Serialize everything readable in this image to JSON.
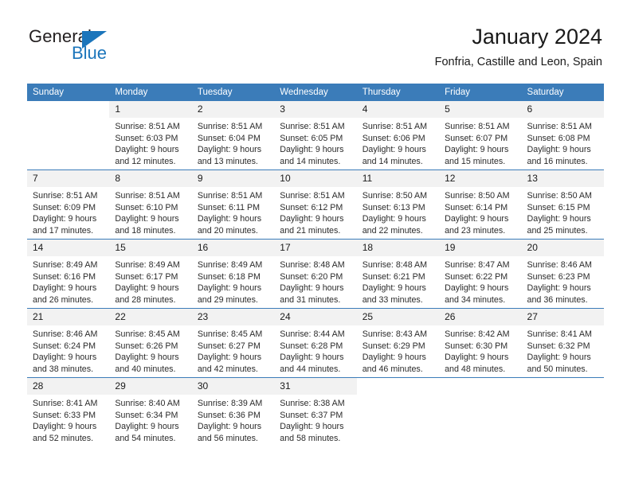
{
  "brand": {
    "name_part1": "General",
    "name_part2": "Blue",
    "triangle_color": "#1b75bb"
  },
  "header": {
    "title": "January 2024",
    "subtitle": "Fonfria, Castille and Leon, Spain",
    "accent_color": "#3b7cb9"
  },
  "weekdays": [
    "Sunday",
    "Monday",
    "Tuesday",
    "Wednesday",
    "Thursday",
    "Friday",
    "Saturday"
  ],
  "weeks": [
    [
      {
        "day": "",
        "blank": true
      },
      {
        "day": "1",
        "sunrise": "Sunrise: 8:51 AM",
        "sunset": "Sunset: 6:03 PM",
        "daylight1": "Daylight: 9 hours",
        "daylight2": "and 12 minutes."
      },
      {
        "day": "2",
        "sunrise": "Sunrise: 8:51 AM",
        "sunset": "Sunset: 6:04 PM",
        "daylight1": "Daylight: 9 hours",
        "daylight2": "and 13 minutes."
      },
      {
        "day": "3",
        "sunrise": "Sunrise: 8:51 AM",
        "sunset": "Sunset: 6:05 PM",
        "daylight1": "Daylight: 9 hours",
        "daylight2": "and 14 minutes."
      },
      {
        "day": "4",
        "sunrise": "Sunrise: 8:51 AM",
        "sunset": "Sunset: 6:06 PM",
        "daylight1": "Daylight: 9 hours",
        "daylight2": "and 14 minutes."
      },
      {
        "day": "5",
        "sunrise": "Sunrise: 8:51 AM",
        "sunset": "Sunset: 6:07 PM",
        "daylight1": "Daylight: 9 hours",
        "daylight2": "and 15 minutes."
      },
      {
        "day": "6",
        "sunrise": "Sunrise: 8:51 AM",
        "sunset": "Sunset: 6:08 PM",
        "daylight1": "Daylight: 9 hours",
        "daylight2": "and 16 minutes."
      }
    ],
    [
      {
        "day": "7",
        "sunrise": "Sunrise: 8:51 AM",
        "sunset": "Sunset: 6:09 PM",
        "daylight1": "Daylight: 9 hours",
        "daylight2": "and 17 minutes."
      },
      {
        "day": "8",
        "sunrise": "Sunrise: 8:51 AM",
        "sunset": "Sunset: 6:10 PM",
        "daylight1": "Daylight: 9 hours",
        "daylight2": "and 18 minutes."
      },
      {
        "day": "9",
        "sunrise": "Sunrise: 8:51 AM",
        "sunset": "Sunset: 6:11 PM",
        "daylight1": "Daylight: 9 hours",
        "daylight2": "and 20 minutes."
      },
      {
        "day": "10",
        "sunrise": "Sunrise: 8:51 AM",
        "sunset": "Sunset: 6:12 PM",
        "daylight1": "Daylight: 9 hours",
        "daylight2": "and 21 minutes."
      },
      {
        "day": "11",
        "sunrise": "Sunrise: 8:50 AM",
        "sunset": "Sunset: 6:13 PM",
        "daylight1": "Daylight: 9 hours",
        "daylight2": "and 22 minutes."
      },
      {
        "day": "12",
        "sunrise": "Sunrise: 8:50 AM",
        "sunset": "Sunset: 6:14 PM",
        "daylight1": "Daylight: 9 hours",
        "daylight2": "and 23 minutes."
      },
      {
        "day": "13",
        "sunrise": "Sunrise: 8:50 AM",
        "sunset": "Sunset: 6:15 PM",
        "daylight1": "Daylight: 9 hours",
        "daylight2": "and 25 minutes."
      }
    ],
    [
      {
        "day": "14",
        "sunrise": "Sunrise: 8:49 AM",
        "sunset": "Sunset: 6:16 PM",
        "daylight1": "Daylight: 9 hours",
        "daylight2": "and 26 minutes."
      },
      {
        "day": "15",
        "sunrise": "Sunrise: 8:49 AM",
        "sunset": "Sunset: 6:17 PM",
        "daylight1": "Daylight: 9 hours",
        "daylight2": "and 28 minutes."
      },
      {
        "day": "16",
        "sunrise": "Sunrise: 8:49 AM",
        "sunset": "Sunset: 6:18 PM",
        "daylight1": "Daylight: 9 hours",
        "daylight2": "and 29 minutes."
      },
      {
        "day": "17",
        "sunrise": "Sunrise: 8:48 AM",
        "sunset": "Sunset: 6:20 PM",
        "daylight1": "Daylight: 9 hours",
        "daylight2": "and 31 minutes."
      },
      {
        "day": "18",
        "sunrise": "Sunrise: 8:48 AM",
        "sunset": "Sunset: 6:21 PM",
        "daylight1": "Daylight: 9 hours",
        "daylight2": "and 33 minutes."
      },
      {
        "day": "19",
        "sunrise": "Sunrise: 8:47 AM",
        "sunset": "Sunset: 6:22 PM",
        "daylight1": "Daylight: 9 hours",
        "daylight2": "and 34 minutes."
      },
      {
        "day": "20",
        "sunrise": "Sunrise: 8:46 AM",
        "sunset": "Sunset: 6:23 PM",
        "daylight1": "Daylight: 9 hours",
        "daylight2": "and 36 minutes."
      }
    ],
    [
      {
        "day": "21",
        "sunrise": "Sunrise: 8:46 AM",
        "sunset": "Sunset: 6:24 PM",
        "daylight1": "Daylight: 9 hours",
        "daylight2": "and 38 minutes."
      },
      {
        "day": "22",
        "sunrise": "Sunrise: 8:45 AM",
        "sunset": "Sunset: 6:26 PM",
        "daylight1": "Daylight: 9 hours",
        "daylight2": "and 40 minutes."
      },
      {
        "day": "23",
        "sunrise": "Sunrise: 8:45 AM",
        "sunset": "Sunset: 6:27 PM",
        "daylight1": "Daylight: 9 hours",
        "daylight2": "and 42 minutes."
      },
      {
        "day": "24",
        "sunrise": "Sunrise: 8:44 AM",
        "sunset": "Sunset: 6:28 PM",
        "daylight1": "Daylight: 9 hours",
        "daylight2": "and 44 minutes."
      },
      {
        "day": "25",
        "sunrise": "Sunrise: 8:43 AM",
        "sunset": "Sunset: 6:29 PM",
        "daylight1": "Daylight: 9 hours",
        "daylight2": "and 46 minutes."
      },
      {
        "day": "26",
        "sunrise": "Sunrise: 8:42 AM",
        "sunset": "Sunset: 6:30 PM",
        "daylight1": "Daylight: 9 hours",
        "daylight2": "and 48 minutes."
      },
      {
        "day": "27",
        "sunrise": "Sunrise: 8:41 AM",
        "sunset": "Sunset: 6:32 PM",
        "daylight1": "Daylight: 9 hours",
        "daylight2": "and 50 minutes."
      }
    ],
    [
      {
        "day": "28",
        "sunrise": "Sunrise: 8:41 AM",
        "sunset": "Sunset: 6:33 PM",
        "daylight1": "Daylight: 9 hours",
        "daylight2": "and 52 minutes."
      },
      {
        "day": "29",
        "sunrise": "Sunrise: 8:40 AM",
        "sunset": "Sunset: 6:34 PM",
        "daylight1": "Daylight: 9 hours",
        "daylight2": "and 54 minutes."
      },
      {
        "day": "30",
        "sunrise": "Sunrise: 8:39 AM",
        "sunset": "Sunset: 6:36 PM",
        "daylight1": "Daylight: 9 hours",
        "daylight2": "and 56 minutes."
      },
      {
        "day": "31",
        "sunrise": "Sunrise: 8:38 AM",
        "sunset": "Sunset: 6:37 PM",
        "daylight1": "Daylight: 9 hours",
        "daylight2": "and 58 minutes."
      },
      {
        "day": "",
        "blank": true
      },
      {
        "day": "",
        "blank": true
      },
      {
        "day": "",
        "blank": true
      }
    ]
  ]
}
